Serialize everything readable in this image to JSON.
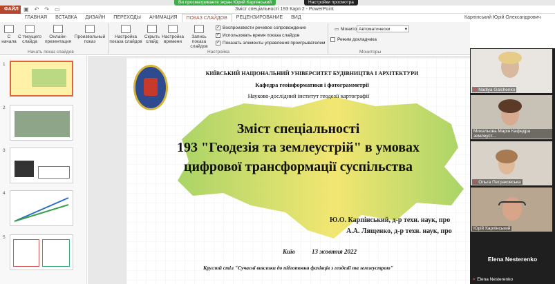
{
  "share_bar": {
    "notice": "Ви просматриваете экран Юрий Карпінський",
    "settings": "Настройки просмотра"
  },
  "titlebar": {
    "file": "ФАЙЛ",
    "doc_title": "Зміст спеціальності 193 Карп 2 - PowerPoint",
    "user": "Карпінський Юрій Олександрович"
  },
  "tabs": [
    {
      "label": "ГЛАВНАЯ"
    },
    {
      "label": "ВСТАВКА"
    },
    {
      "label": "ДИЗАЙН"
    },
    {
      "label": "ПЕРЕХОДЫ"
    },
    {
      "label": "АНИМАЦИЯ"
    },
    {
      "label": "ПОКАЗ СЛАЙДОВ"
    },
    {
      "label": "РЕЦЕНЗИРОВАНИЕ"
    },
    {
      "label": "ВИД"
    }
  ],
  "ribbon": {
    "buttons": [
      "С начала",
      "С текущего слайда",
      "Онлайн-презентация",
      "Произвольный показ",
      "Настройка показа слайдов",
      "Скрыть слайд",
      "Настройка времени",
      "Запись показа слайдов"
    ],
    "group_start": "Начать показ слайдов",
    "group_setup": "Настройка",
    "group_monitors": "Мониторы",
    "chk_narration": "Воспроизвести речевое сопровождение",
    "chk_timings": "Использовать время показа слайдов",
    "chk_controls": "Показать элементы управления проигрывателем",
    "monitor_label": "Монитор:",
    "monitor_value": "Автоматически",
    "presenter_view": "Режим докладчика"
  },
  "thumbs": [
    {
      "n": "1"
    },
    {
      "n": "2"
    },
    {
      "n": "3"
    },
    {
      "n": "4"
    },
    {
      "n": "5"
    }
  ],
  "slide": {
    "university": "КИЇВСЬКИЙ НАЦІОНАЛЬНИЙ УНІВЕРСИТЕТ БУДІВНИЦТВА І АРХІТЕКТУРИ",
    "department": "Кафедра геоінформатики і фотограмметрії",
    "institute": "Науково-дослідний інститут геодезії картографії",
    "title1": "Зміст спеціальності",
    "title2": "193 \"Геодезія та землеустрій\"  в умовах",
    "title3": "цифрової трансформації суспільства",
    "author1": "Ю.О.  Карпінський, д-р техн. наук, про",
    "author2": "А.А. Лященко, д-р техн. наук, про",
    "city": "Київ",
    "date": "13 жовтня 2022",
    "roundtable": "Круглий стіл  \"Сучасні виклики до підготовки фахівців з геодезії та землеустрою\""
  },
  "participants": [
    {
      "name": "Nadiya Galchenko"
    },
    {
      "name": "Михальова Марія Кафедра землеуст..."
    },
    {
      "name": "Ольга Петраковська"
    },
    {
      "name": "Юрій Карпінський"
    },
    {
      "name": "Elena Nesterenko"
    }
  ],
  "colors": {
    "accent": "#b7472a",
    "share_green": "#3fae49",
    "map_green": "#9ccc5a",
    "map_yellow": "#f2e56b"
  }
}
